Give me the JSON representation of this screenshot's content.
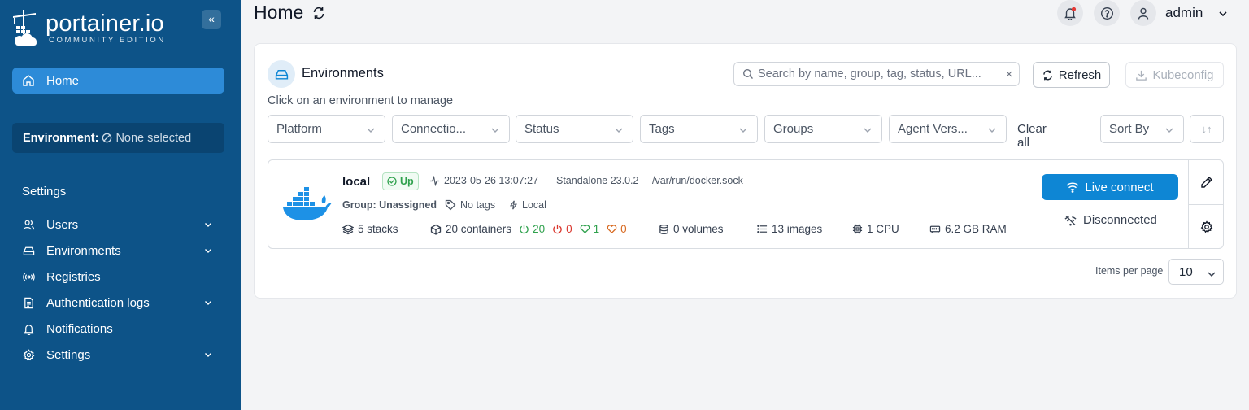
{
  "brand": {
    "name": "portainer.io",
    "edition": "COMMUNITY EDITION"
  },
  "sidebar": {
    "collapse_label": "«",
    "home_label": "Home",
    "environment_label": "Environment:",
    "environment_value": "None selected",
    "settings_title": "Settings",
    "items": [
      {
        "label": "Users",
        "icon": "users-icon",
        "expandable": true
      },
      {
        "label": "Environments",
        "icon": "hdd-icon",
        "expandable": true
      },
      {
        "label": "Registries",
        "icon": "radio-icon",
        "expandable": false
      },
      {
        "label": "Authentication logs",
        "icon": "file-text-icon",
        "expandable": true
      },
      {
        "label": "Notifications",
        "icon": "bell-icon",
        "expandable": false
      },
      {
        "label": "Settings",
        "icon": "gear-icon",
        "expandable": true
      }
    ]
  },
  "header": {
    "title": "Home",
    "user": "admin"
  },
  "environments": {
    "title": "Environments",
    "subtitle": "Click on an environment to manage",
    "search_placeholder": "Search by name, group, tag, status, URL...",
    "clear_search": "×",
    "refresh_label": "Refresh",
    "kubeconfig_label": "Kubeconfig",
    "filters": {
      "platform": "Platform",
      "connection": "Connectio...",
      "status": "Status",
      "tags": "Tags",
      "groups": "Groups",
      "agent_version": "Agent Vers...",
      "clear_all": "Clear all",
      "sort_by": "Sort By",
      "sort_toggle": "↓↑"
    },
    "item": {
      "name": "local",
      "status": "Up",
      "timestamp": "2023-05-26 13:07:27",
      "type": "Standalone 23.0.2",
      "url": "/var/run/docker.sock",
      "group_label": "Group:",
      "group_value": "Unassigned",
      "tags": "No tags",
      "connection": "Local",
      "stacks": "5 stacks",
      "containers": "20 containers",
      "running": "20",
      "stopped": "0",
      "healthy": "1",
      "unhealthy": "0",
      "volumes": "0 volumes",
      "images": "13 images",
      "cpu": "1 CPU",
      "ram": "6.2 GB RAM",
      "live_connect": "Live connect",
      "disconnected": "Disconnected"
    },
    "pagination": {
      "label": "Items per page",
      "value": "10"
    }
  },
  "colors": {
    "sidebar_bg": "#0d5388",
    "active_nav": "#2d8bd8",
    "primary": "#0e86d4",
    "success": "#2fa14d",
    "danger": "#d9342b",
    "warning": "#d86a21"
  }
}
